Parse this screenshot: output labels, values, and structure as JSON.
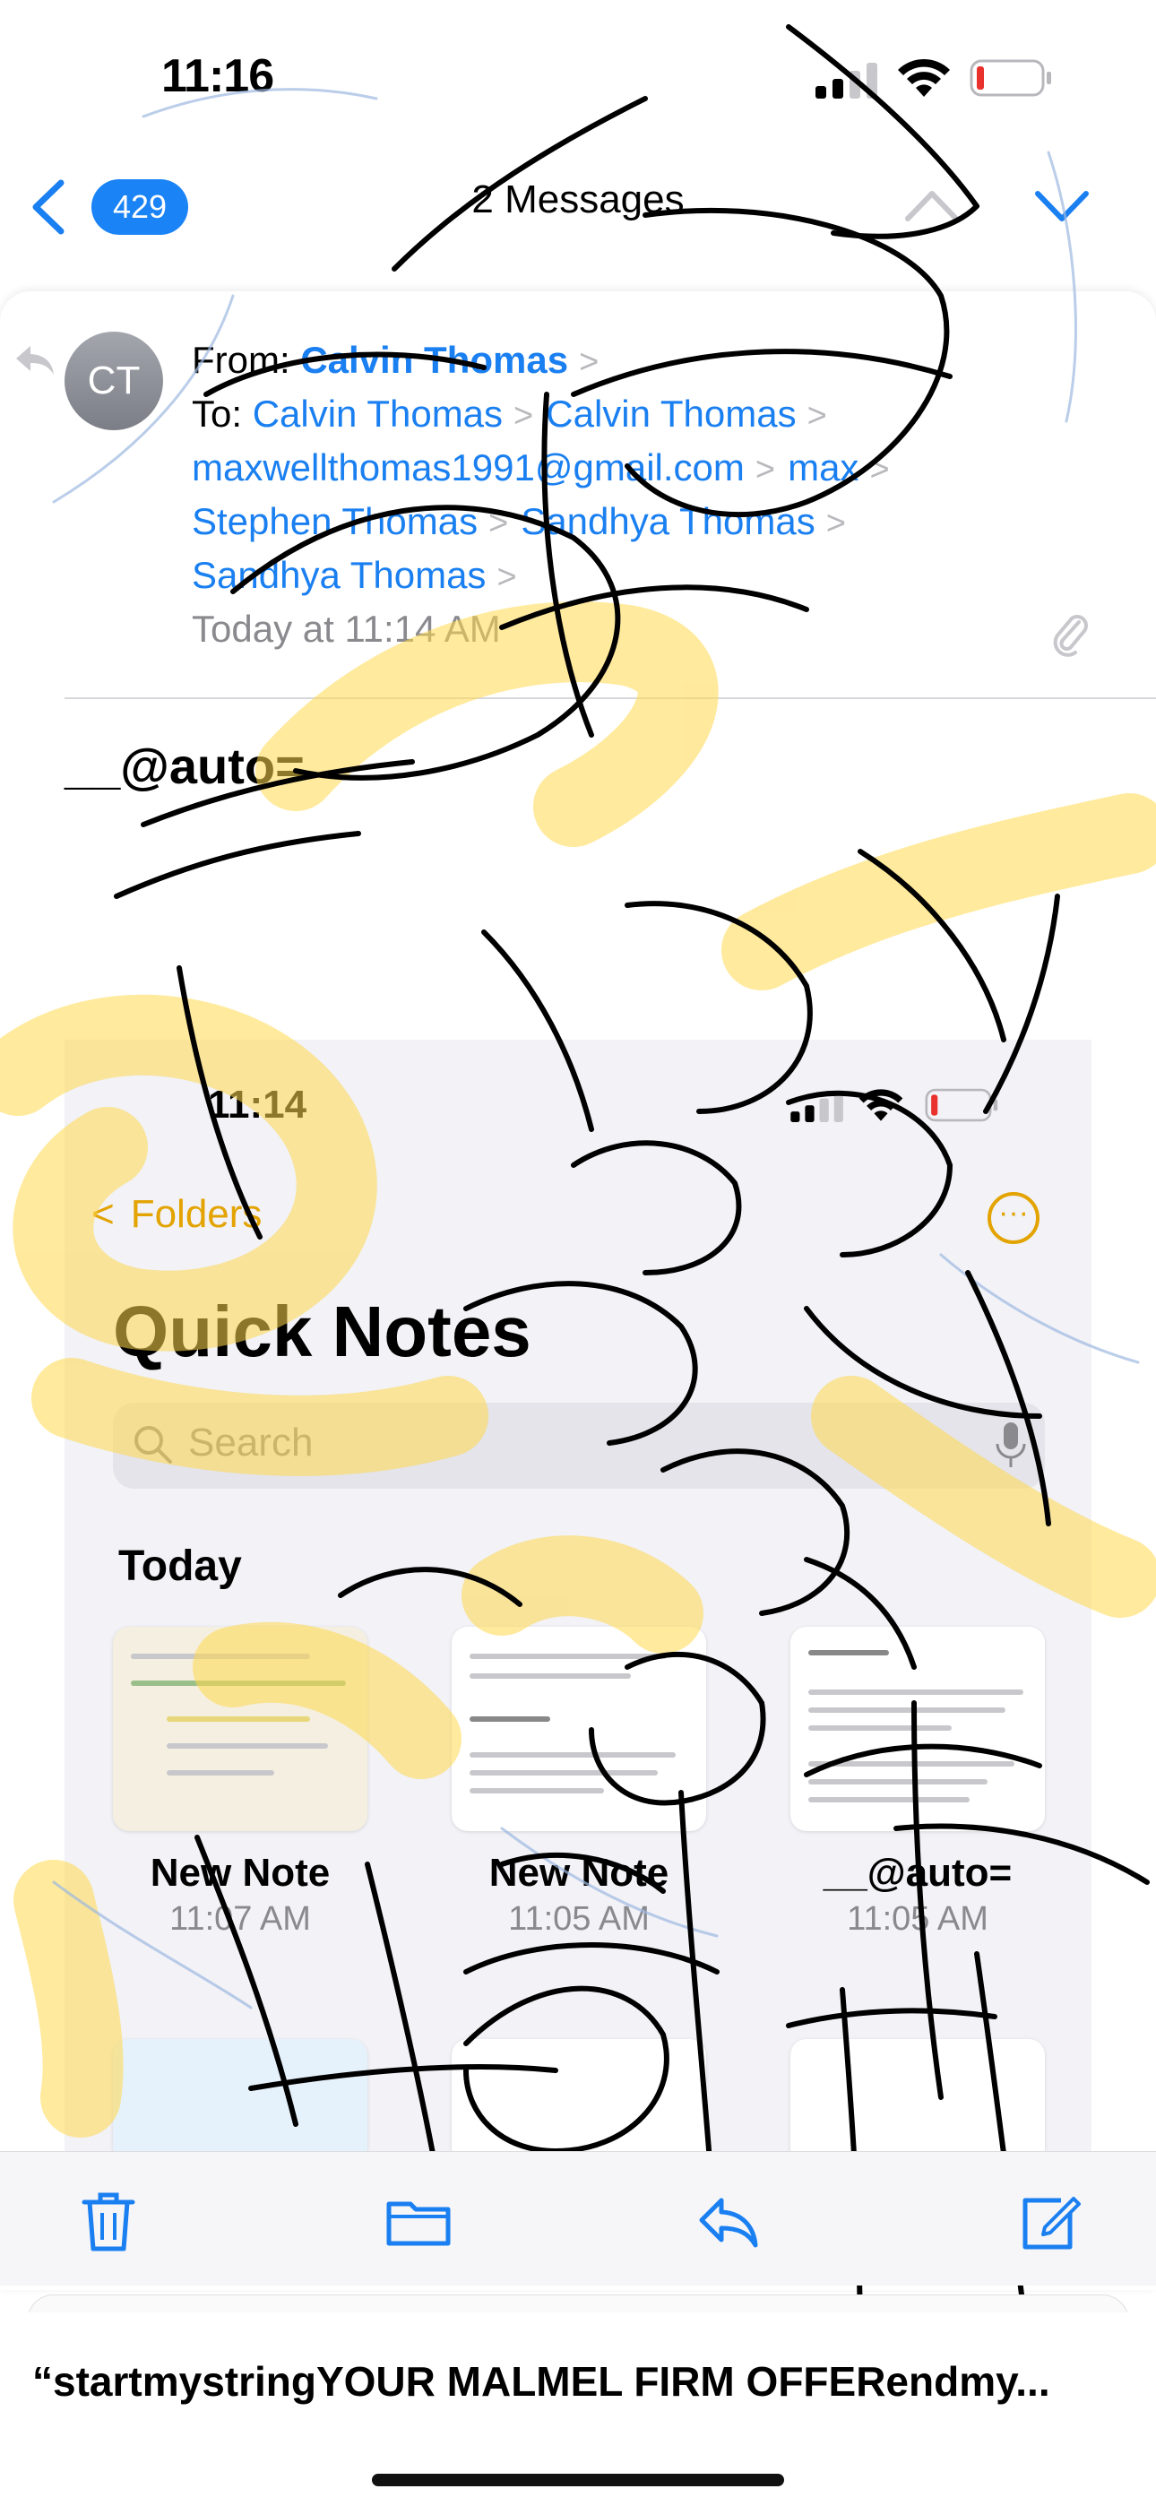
{
  "status_bar": {
    "time": "11:16"
  },
  "nav": {
    "unread_count": "429",
    "title": "2 Messages"
  },
  "message": {
    "avatar_initials": "CT",
    "from_label": "From:",
    "from_name": "Calvin Thomas",
    "to_label": "To:",
    "recipients": [
      "Calvin Thomas",
      "Calvin Thomas",
      "maxwellthomas1991@gmail.com",
      "max",
      "Stephen Thomas",
      "Sandhya Thomas",
      "Sandhya Thomas"
    ],
    "date": "Today at 11:14 AM",
    "body_text": "__@auto="
  },
  "embedded_screenshot": {
    "time": "11:14",
    "back_label": "Folders",
    "title": "Quick Notes",
    "search_placeholder": "Search",
    "section": "Today",
    "notes": [
      {
        "title": "New Note",
        "time": "11:07 AM"
      },
      {
        "title": "New Note",
        "time": "11:05 AM"
      },
      {
        "title": "__@auto=",
        "time": "11:05 AM"
      }
    ]
  },
  "next_message": {
    "subject": "“startmystringYOUR MALMEL FIRM OFFERendmy..."
  },
  "colors": {
    "accent": "#1a7ff0",
    "badge": "#1a83f5",
    "notes_accent": "#e3a300",
    "highlighter": "#ffd84d"
  }
}
